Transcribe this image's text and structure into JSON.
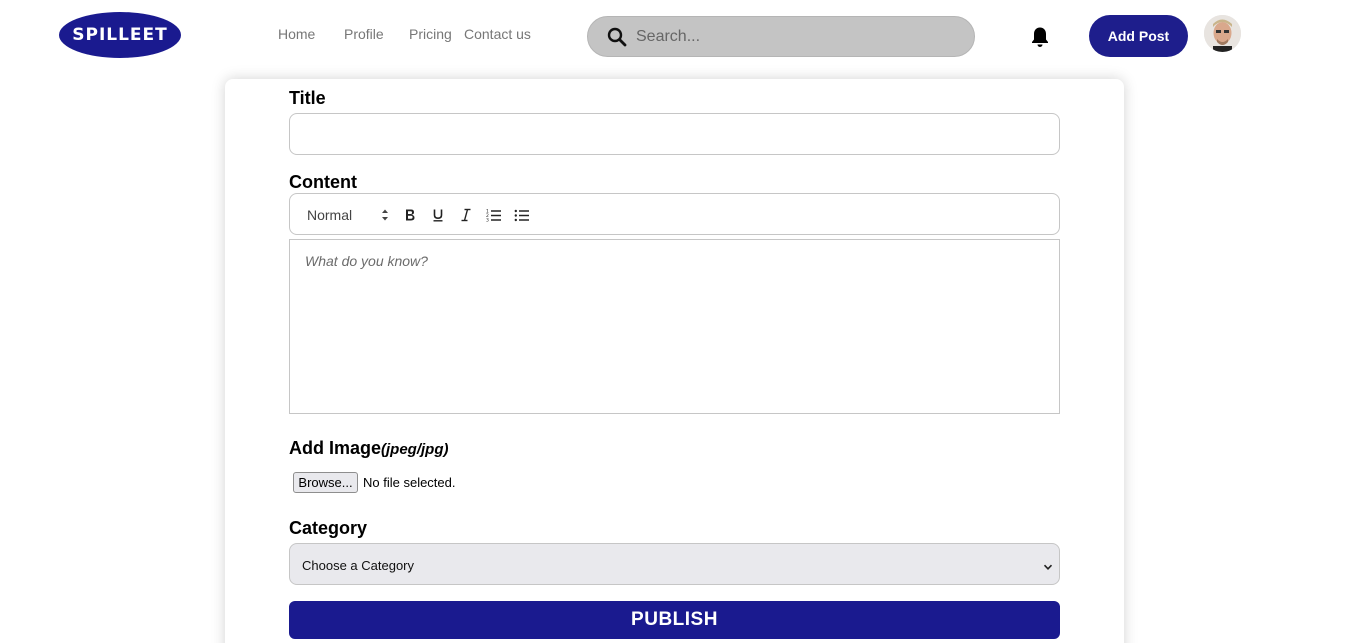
{
  "header": {
    "logo_text": "SPILLEET",
    "nav": [
      {
        "label": "Home"
      },
      {
        "label": "Profile"
      },
      {
        "label": "Pricing"
      },
      {
        "label": "Contact us"
      }
    ],
    "search": {
      "placeholder": "Search...",
      "value": ""
    },
    "add_post_label": "Add Post",
    "icons": {
      "search": "search-icon",
      "notifications": "bell-icon",
      "avatar": "user-avatar"
    }
  },
  "form": {
    "title_label": "Title",
    "title_value": "",
    "content_label": "Content",
    "toolbar": {
      "format_value": "Normal",
      "buttons": [
        "bold-icon",
        "underline-icon",
        "italic-icon",
        "ordered-list-icon",
        "bullet-list-icon"
      ]
    },
    "editor_placeholder": "What do you know?",
    "image_label": "Add Image",
    "image_hint": "(jpeg/jpg)",
    "browse_label": "Browse...",
    "file_status": "No file selected.",
    "category_label": "Category",
    "category_value": "Choose a Category",
    "publish_label": "PUBLISH"
  },
  "colors": {
    "brand": "#1a1a8f",
    "search_bg": "#c4c4c4",
    "select_bg": "#e9e9ed"
  }
}
